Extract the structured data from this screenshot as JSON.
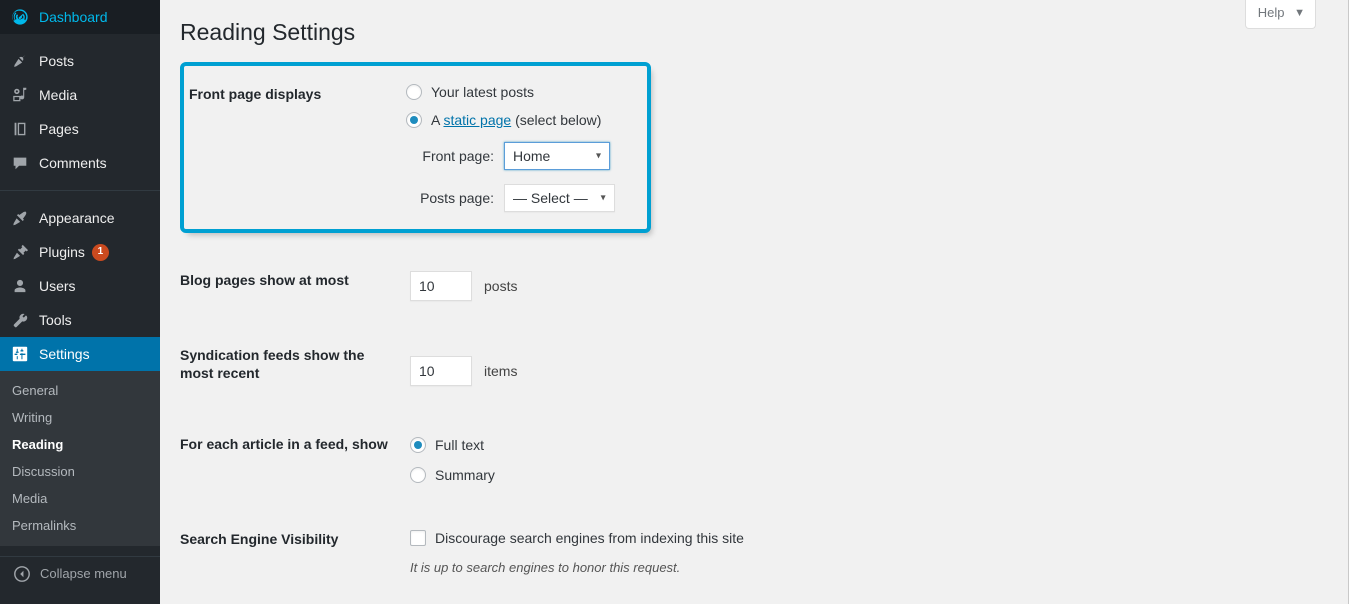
{
  "sidebar": {
    "items": [
      {
        "label": "Dashboard",
        "icon": "dashboard-icon",
        "name": "dashboard"
      },
      {
        "label": "Posts",
        "icon": "pin-icon",
        "name": "posts"
      },
      {
        "label": "Media",
        "icon": "media-icon",
        "name": "media"
      },
      {
        "label": "Pages",
        "icon": "pages-icon",
        "name": "pages"
      },
      {
        "label": "Comments",
        "icon": "comment-icon",
        "name": "comments"
      },
      {
        "label": "Appearance",
        "icon": "paintbrush-icon",
        "name": "appearance"
      },
      {
        "label": "Plugins",
        "icon": "plug-icon",
        "name": "plugins",
        "badge": "1"
      },
      {
        "label": "Users",
        "icon": "user-icon",
        "name": "users"
      },
      {
        "label": "Tools",
        "icon": "wrench-icon",
        "name": "tools"
      },
      {
        "label": "Settings",
        "icon": "settings-icon",
        "name": "settings",
        "current": true
      }
    ],
    "submenu": [
      {
        "label": "General",
        "name": "general"
      },
      {
        "label": "Writing",
        "name": "writing"
      },
      {
        "label": "Reading",
        "name": "reading",
        "current": true
      },
      {
        "label": "Discussion",
        "name": "discussion"
      },
      {
        "label": "Media",
        "name": "media"
      },
      {
        "label": "Permalinks",
        "name": "permalinks"
      }
    ],
    "collapse_label": "Collapse menu",
    "accent_current": "#0073aa",
    "background": "#23282d",
    "submenu_background": "#32373c",
    "badge_color": "#ca4a1f"
  },
  "header": {
    "page_title": "Reading Settings",
    "help_label": "Help",
    "help_caret": "▼"
  },
  "settings": {
    "front_page_displays": {
      "label": "Front page displays",
      "highlight_color": "#00a0d2",
      "options": [
        {
          "label": "Your latest posts",
          "checked": false,
          "name": "latest-posts"
        },
        {
          "label_prefix": "A ",
          "link_text": "static page",
          "label_suffix": " (select below)",
          "checked": true,
          "name": "static-page"
        }
      ],
      "front_page": {
        "label": "Front page:",
        "value": "Home",
        "focused": true,
        "arrow": "▾"
      },
      "posts_page": {
        "label": "Posts page:",
        "value": "— Select —",
        "focused": false,
        "arrow": "▾"
      }
    },
    "blog_pages": {
      "label": "Blog pages show at most",
      "value": "10",
      "unit": "posts"
    },
    "syndication_feeds": {
      "label": "Syndication feeds show the most recent",
      "value": "10",
      "unit": "items"
    },
    "feed_article": {
      "label": "For each article in a feed, show",
      "options": [
        {
          "label": "Full text",
          "checked": true,
          "name": "full-text"
        },
        {
          "label": "Summary",
          "checked": false,
          "name": "summary"
        }
      ]
    },
    "search_engine_visibility": {
      "label": "Search Engine Visibility",
      "checkbox_label": "Discourage search engines from indexing this site",
      "checked": false,
      "note": "It is up to search engines to honor this request."
    }
  }
}
